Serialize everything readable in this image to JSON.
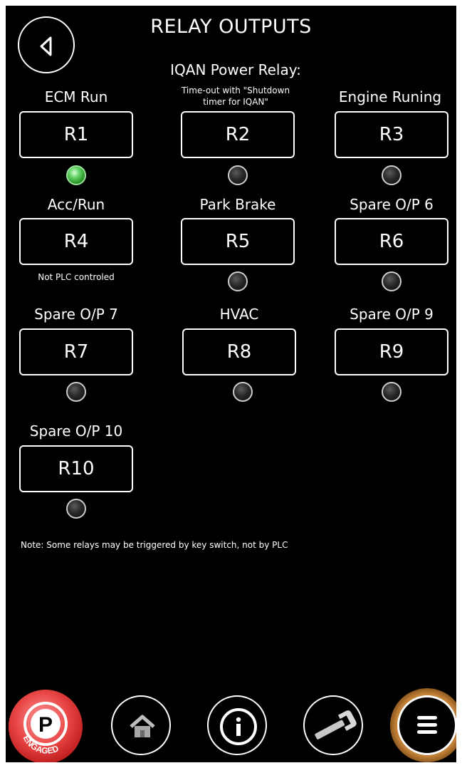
{
  "header": {
    "title": "RELAY OUTPUTS"
  },
  "relays": [
    {
      "name": "ECM Run",
      "label": "R1",
      "state": "on"
    },
    {
      "name": "IQAN Power Relay:",
      "note": "Time-out with \"Shutdown timer for IQAN\"",
      "label": "R2",
      "state": "off"
    },
    {
      "name": "Engine Runing",
      "label": "R3",
      "state": "off"
    },
    {
      "name": "Acc/Run",
      "note": "Not PLC controled",
      "label": "R4"
    },
    {
      "name": "Park Brake",
      "label": "R5",
      "state": "off"
    },
    {
      "name": "Spare O/P 6",
      "label": "R6",
      "state": "off"
    },
    {
      "name": "Spare O/P 7",
      "label": "R7",
      "state": "off"
    },
    {
      "name": "HVAC",
      "label": "R8",
      "state": "off"
    },
    {
      "name": "Spare O/P 9",
      "label": "R9",
      "state": "off"
    },
    {
      "name": "Spare O/P 10",
      "label": "R10",
      "state": "off"
    }
  ],
  "footer_note": "Note: Some relays may be triggered by key switch, not by PLC",
  "nav": {
    "park": {
      "letter": "P",
      "status": "ENGAGED"
    },
    "icons": [
      "back-icon",
      "home-icon",
      "info-icon",
      "wrench-icon",
      "menu-icon"
    ]
  },
  "colors": {
    "background": "#000000",
    "foreground": "#ffffff",
    "led_on": "#3cc03c",
    "park": "#e03a3a",
    "menu_ring": "#c9863a"
  }
}
